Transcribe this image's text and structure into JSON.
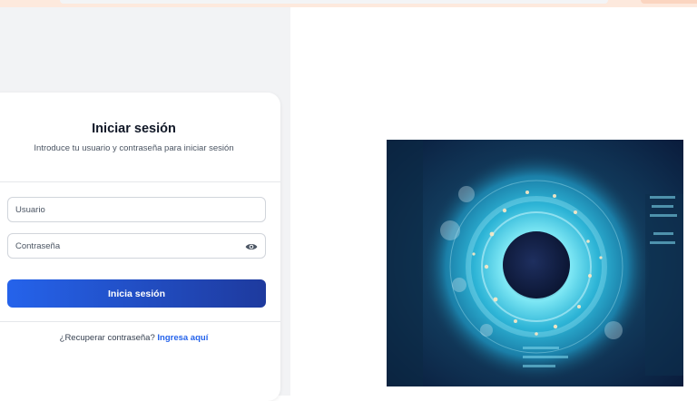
{
  "login": {
    "title": "Iniciar sesión",
    "subtitle": "Introduce tu usuario y contraseña para iniciar sesión",
    "username_placeholder": "Usuario",
    "password_placeholder": "Contraseña",
    "submit_label": "Inicia sesión",
    "recover_text": "¿Recuperar contraseña?",
    "recover_link": "Ingresa aquí"
  },
  "colors": {
    "primary": "#2563eb",
    "primary_dark": "#1e3a9e",
    "panel_bg": "#f2f3f5"
  },
  "icons": {
    "password_toggle": "eye-icon",
    "hero": "cyber-eye-illustration"
  }
}
